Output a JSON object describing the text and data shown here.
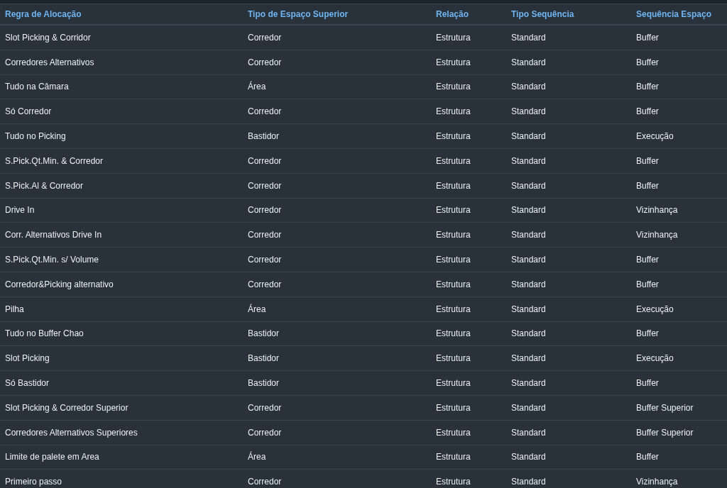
{
  "table": {
    "columns": [
      "Regra de Alocação",
      "Tipo de Espaço Superior",
      "Relação",
      "Tipo Sequência",
      "Sequência Espaço"
    ],
    "rows": [
      [
        "Slot Picking & Corridor",
        "Corredor",
        "Estrutura",
        "Standard",
        "Buffer"
      ],
      [
        "Corredores Alternativos",
        "Corredor",
        "Estrutura",
        "Standard",
        "Buffer"
      ],
      [
        "Tudo na Câmara",
        "Área",
        "Estrutura",
        "Standard",
        "Buffer"
      ],
      [
        "Só Corredor",
        "Corredor",
        "Estrutura",
        "Standard",
        "Buffer"
      ],
      [
        "Tudo no Picking",
        "Bastidor",
        "Estrutura",
        "Standard",
        "Execução"
      ],
      [
        "S.Pick.Qt.Min. & Corredor",
        "Corredor",
        "Estrutura",
        "Standard",
        "Buffer"
      ],
      [
        "S.Pick.Al & Corredor",
        "Corredor",
        "Estrutura",
        "Standard",
        "Buffer"
      ],
      [
        "Drive In",
        "Corredor",
        "Estrutura",
        "Standard",
        "Vizinhança"
      ],
      [
        "Corr. Alternativos Drive In",
        "Corredor",
        "Estrutura",
        "Standard",
        "Vizinhança"
      ],
      [
        "S.Pick.Qt.Min. s/ Volume",
        "Corredor",
        "Estrutura",
        "Standard",
        "Buffer"
      ],
      [
        "Corredor&Picking alternativo",
        "Corredor",
        "Estrutura",
        "Standard",
        "Buffer"
      ],
      [
        "Pilha",
        "Área",
        "Estrutura",
        "Standard",
        "Execução"
      ],
      [
        "Tudo no Buffer Chao",
        "Bastidor",
        "Estrutura",
        "Standard",
        "Buffer"
      ],
      [
        "Slot Picking",
        "Bastidor",
        "Estrutura",
        "Standard",
        "Execução"
      ],
      [
        "Só Bastidor",
        "Bastidor",
        "Estrutura",
        "Standard",
        "Buffer"
      ],
      [
        "Slot Picking & Corredor Superior",
        "Corredor",
        "Estrutura",
        "Standard",
        "Buffer Superior"
      ],
      [
        "Corredores Alternativos Superiores",
        "Corredor",
        "Estrutura",
        "Standard",
        "Buffer Superior"
      ],
      [
        "Limite de palete em Area",
        "Área",
        "Estrutura",
        "Standard",
        "Buffer"
      ],
      [
        "Primeiro passo",
        "Corredor",
        "Estrutura",
        "Standard",
        "Vizinhança"
      ]
    ]
  }
}
